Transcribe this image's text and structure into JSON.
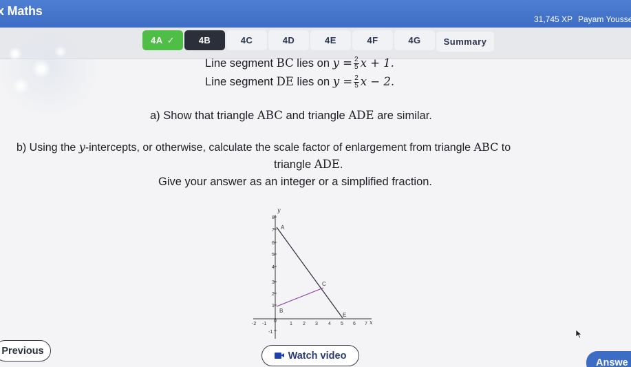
{
  "header": {
    "app_title": "x Maths",
    "xp": "31,745 XP",
    "user": "Payam Yousse"
  },
  "tabs": [
    {
      "label": "4A",
      "state": "done",
      "check": "✓"
    },
    {
      "label": "4B",
      "state": "active"
    },
    {
      "label": "4C",
      "state": "default"
    },
    {
      "label": "4D",
      "state": "default"
    },
    {
      "label": "4E",
      "state": "default"
    },
    {
      "label": "4F",
      "state": "default"
    },
    {
      "label": "4G",
      "state": "default"
    },
    {
      "label": "Summary",
      "state": "default"
    }
  ],
  "question": {
    "bc_prefix": "Line segment ",
    "bc_name": "BC",
    "bc_mid": " lies on ",
    "bc_lhs": "y =",
    "bc_num": "2",
    "bc_den": "5",
    "bc_rhs": "x + 1.",
    "de_prefix": "Line segment ",
    "de_name": "DE",
    "de_mid": " lies on ",
    "de_lhs": "y =",
    "de_num": "2",
    "de_den": "5",
    "de_rhs": "x − 2.",
    "part_a_prefix": "a) Show that triangle ",
    "part_a_t1": "ABC",
    "part_a_mid": " and triangle ",
    "part_a_t2": "ADE",
    "part_a_suffix": " are similar.",
    "part_b_prefix": "b) Using the ",
    "part_b_var": "y",
    "part_b_rest": "-intercepts, or otherwise, calculate the scale factor of enlargement from triangle ",
    "part_b_t1": "ABC",
    "part_b_to": " to",
    "part_b_line2_prefix": "triangle ",
    "part_b_t2": "ADE",
    "part_b_line2_suffix": ".",
    "part_b_line3": "Give your answer as an integer or a simplified fraction."
  },
  "graph": {
    "x_axis_label": "x",
    "y_axis_label": "y",
    "x_ticks": [
      "-2",
      "-1",
      "0",
      "1",
      "2",
      "3",
      "4",
      "5",
      "6",
      "7"
    ],
    "y_ticks": [
      "-1",
      "1",
      "2",
      "3",
      "4",
      "5",
      "6",
      "7",
      "8"
    ],
    "points": [
      {
        "label": "A",
        "x": 0,
        "y": 7
      },
      {
        "label": "B",
        "x": 0,
        "y": 1
      },
      {
        "label": "C",
        "x": 3,
        "y": 2.2
      },
      {
        "label": "E",
        "x": 4.8,
        "y": -0.1
      }
    ],
    "colors": {
      "line_ab": "#2a2a3a",
      "line_bc": "#8a3fa6",
      "line_ae": "#2a2a3a"
    }
  },
  "buttons": {
    "previous": "Previous",
    "watch_video": "Watch video",
    "answer": "Answe"
  },
  "colors": {
    "header_bg": "#4275cb",
    "tab_done": "#4fbe47",
    "tab_active": "#2b2f3a"
  }
}
